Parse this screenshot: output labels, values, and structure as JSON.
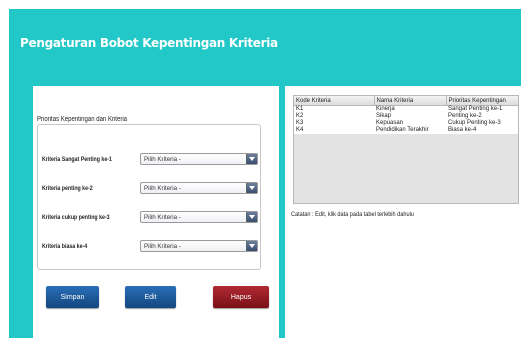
{
  "header": {
    "title": "Pengaturan Bobot Kepentingan Kriteria"
  },
  "form": {
    "section_label": "Prioritas Kepentingan dari Kriteria",
    "rows": [
      {
        "label": "Kriteria Sangat Penting ke-1",
        "value": "Pilih Kriteria -"
      },
      {
        "label": "Kriteria penting ke-2",
        "value": "Pilih Kriteria -"
      },
      {
        "label": "Kriteria cukup penting ke-3",
        "value": "Pilih Kriteria -"
      },
      {
        "label": "Kriteria biasa ke-4",
        "value": "Pilih Kriteria -"
      }
    ],
    "buttons": {
      "save": "Simpan",
      "edit": "Edit",
      "delete": "Hapus"
    }
  },
  "table": {
    "columns": [
      "Kode Kriteria",
      "Nama Kriteria",
      "Prioritas Kepentingan"
    ],
    "rows": [
      [
        "K1",
        "Kinerja",
        "Sangat Penting ke-1"
      ],
      [
        "K2",
        "Sikap",
        "Penting ke-2"
      ],
      [
        "K3",
        "Kepuasan",
        "Cukup Penting ke-3"
      ],
      [
        "K4",
        "Pendidikan Terakhir",
        "Biasa ke-4"
      ]
    ]
  },
  "note": "Catatan : Edit, klik data pada tabel terlebih dahulu",
  "colors": {
    "background": "#22c7c7",
    "primary_button": "#1f5a9c",
    "danger_button": "#9c1c24"
  }
}
